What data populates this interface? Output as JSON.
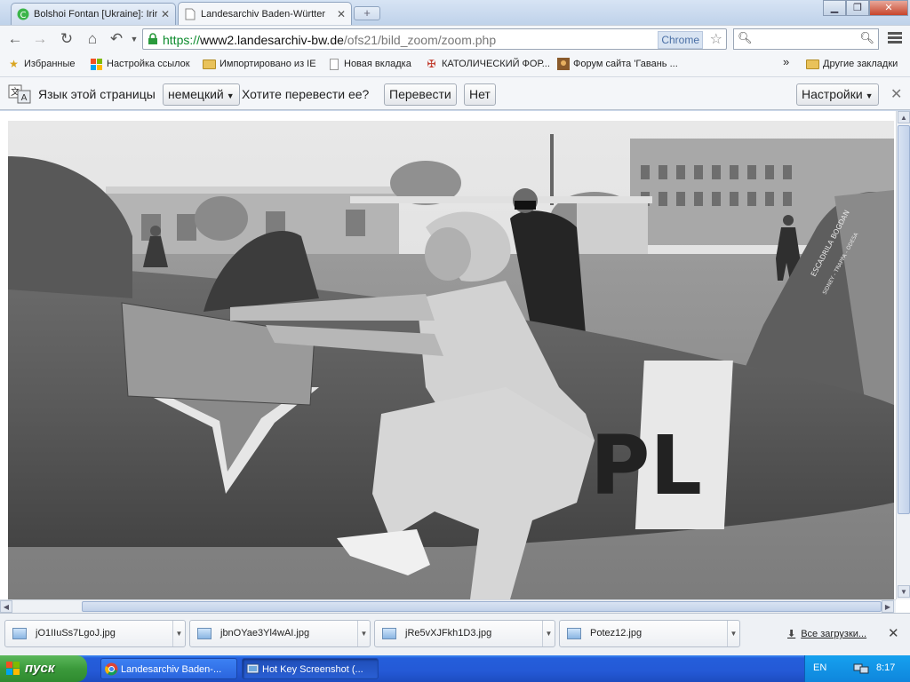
{
  "tabs": [
    {
      "title": "Bolshoi Fontan [Ukraine]: Irir",
      "active": false
    },
    {
      "title": "Landesarchiv Baden-Württer",
      "active": true
    }
  ],
  "window": {
    "minimize": "▁",
    "maximize": "❐",
    "close": "✕"
  },
  "toolbar": {
    "url_proto": "https://",
    "url_host": "www2.landesarchiv-bw.de",
    "url_path": "/ofs21/bild_zoom/zoom.php",
    "badge": "Chrome"
  },
  "bookmarks": [
    {
      "label": "Избранные",
      "icon": "star-icon"
    },
    {
      "label": "Настройка ссылок",
      "icon": "windows-icon"
    },
    {
      "label": "Импортировано из IE",
      "icon": "folder-icon"
    },
    {
      "label": "Новая вкладка",
      "icon": "page-icon"
    },
    {
      "label": "КАТОЛИЧЕСКИЙ ФОР...",
      "icon": "cross-icon"
    },
    {
      "label": "Форум сайта 'Гавань ...",
      "icon": "picture-icon"
    },
    {
      "label": "»",
      "icon": ""
    },
    {
      "label": "Другие закладки",
      "icon": "folder-icon"
    }
  ],
  "translate_bar": {
    "prompt": "Язык этой страницы",
    "language": "немецкий",
    "question": "Хотите перевести ее?",
    "translate_btn": "Перевести",
    "no_btn": "Нет",
    "settings_btn": "Настройки"
  },
  "downloads": {
    "items": [
      {
        "name": "jO1IIuSs7LgoJ.jpg"
      },
      {
        "name": "jbnOYae3Yl4wAI.jpg"
      },
      {
        "name": "jRe5vXJFkh1D3.jpg"
      },
      {
        "name": "Potez12.jpg"
      }
    ],
    "show_all": "Все загрузки..."
  },
  "taskbar": {
    "start": "пуск",
    "tasks": [
      {
        "label": "Landesarchiv Baden-...",
        "active": false
      },
      {
        "label": "Hot Key Screenshot (...",
        "active": true
      }
    ],
    "lang": "EN",
    "clock": "8:17"
  },
  "photo": {
    "plane_letters": "PL",
    "tail_text_1": "ESCADRILA BOGDAN",
    "tail_text_2": "SIDNEY - TRAPPA - ODESA"
  }
}
